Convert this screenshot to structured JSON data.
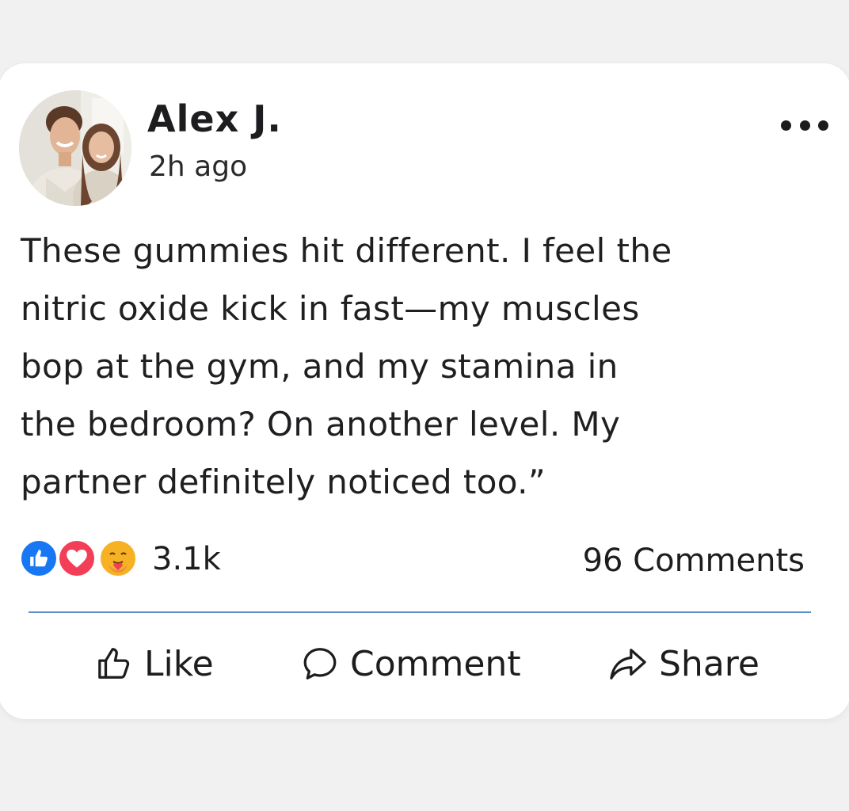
{
  "post": {
    "author": "Alex J.",
    "time": "2h ago",
    "lines": [
      " These gummies hit different. I feel the",
      "nitric oxide kick in fast—my muscles",
      "bop at the gym, and my stamina in",
      "the bedroom? On another level. My",
      "partner definitely noticed too.”"
    ],
    "avatar_icon": "profile-photo-couple",
    "more_icon": "more-options-icon"
  },
  "stats": {
    "reactions_count": "3.1k",
    "comments_count": "96 Comments",
    "reaction_icons": [
      "like-reaction-icon",
      "love-reaction-icon",
      "care-reaction-icon"
    ]
  },
  "actions": {
    "like": "Like",
    "comment": "Comment",
    "share": "Share"
  },
  "colors": {
    "like_blue": "#1877f2",
    "love_red": "#f33e58",
    "care_yellow": "#f7b125",
    "divider": "#5b8fc7",
    "background": "#f1f1f2",
    "card": "#ffffff"
  }
}
